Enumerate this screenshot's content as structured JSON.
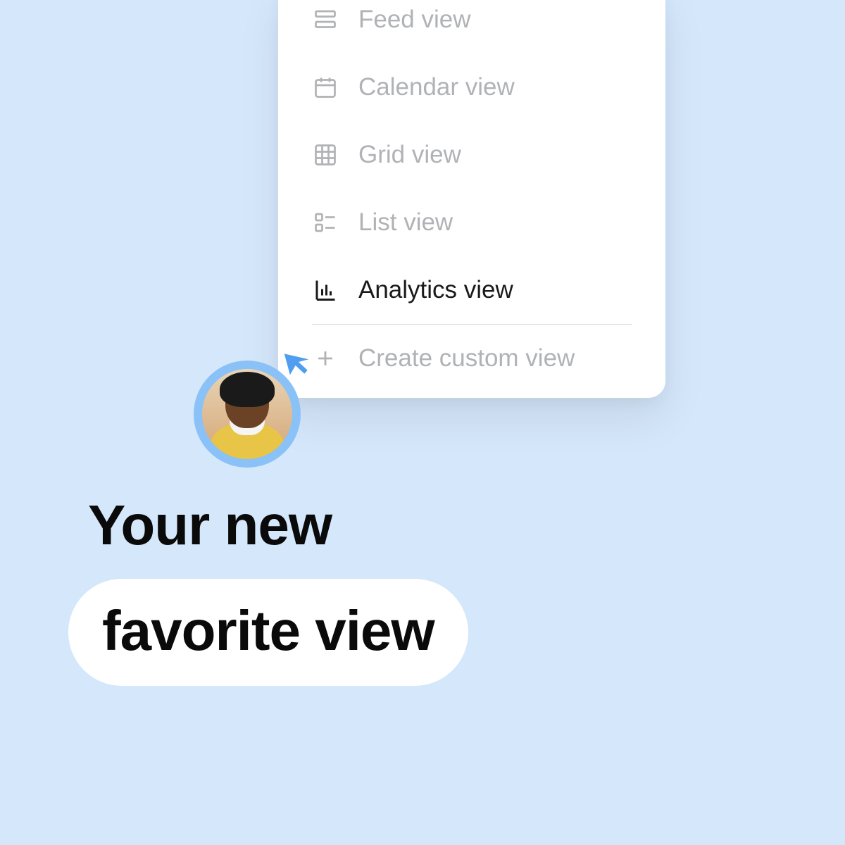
{
  "menu": {
    "items": [
      {
        "label": "Feed view",
        "icon": "feed-icon",
        "active": false
      },
      {
        "label": "Calendar view",
        "icon": "calendar-icon",
        "active": false
      },
      {
        "label": "Grid view",
        "icon": "grid-icon",
        "active": false
      },
      {
        "label": "List view",
        "icon": "list-icon",
        "active": false
      },
      {
        "label": "Analytics view",
        "icon": "analytics-icon",
        "active": true
      }
    ],
    "create_label": "Create custom view"
  },
  "headline": {
    "line1": "Your new",
    "line2": "favorite view"
  }
}
